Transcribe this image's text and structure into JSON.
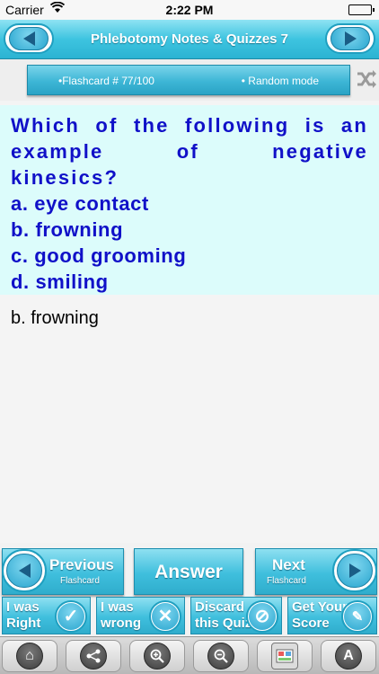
{
  "status_bar": {
    "carrier": "Carrier",
    "time": "2:22 PM"
  },
  "header": {
    "title": "Phlebotomy Notes & Quizzes 7"
  },
  "info": {
    "flashcard": "•Flashcard #  77/100",
    "mode": "• Random mode"
  },
  "question": {
    "stem": "Which of the following is an example of negative kinesics?",
    "options": [
      "a. eye contact",
      "b. frowning",
      "c. good grooming",
      "d. smiling"
    ]
  },
  "answer": "b. frowning",
  "nav": {
    "previous_big": "Previous",
    "previous_small": "Flashcard",
    "answer": "Answer",
    "next_big": "Next",
    "next_small": "Flashcard"
  },
  "actions": [
    {
      "line1": "I was",
      "line2": "Right"
    },
    {
      "line1": "I was",
      "line2": "wrong"
    },
    {
      "line1": "Discard",
      "line2": "this Quiz"
    },
    {
      "line1": "Get Your",
      "line2": "Score"
    }
  ],
  "toolbar": [
    "home-icon",
    "share-icon",
    "zoom-in-icon",
    "zoom-out-icon",
    "image-icon",
    "font-icon"
  ]
}
